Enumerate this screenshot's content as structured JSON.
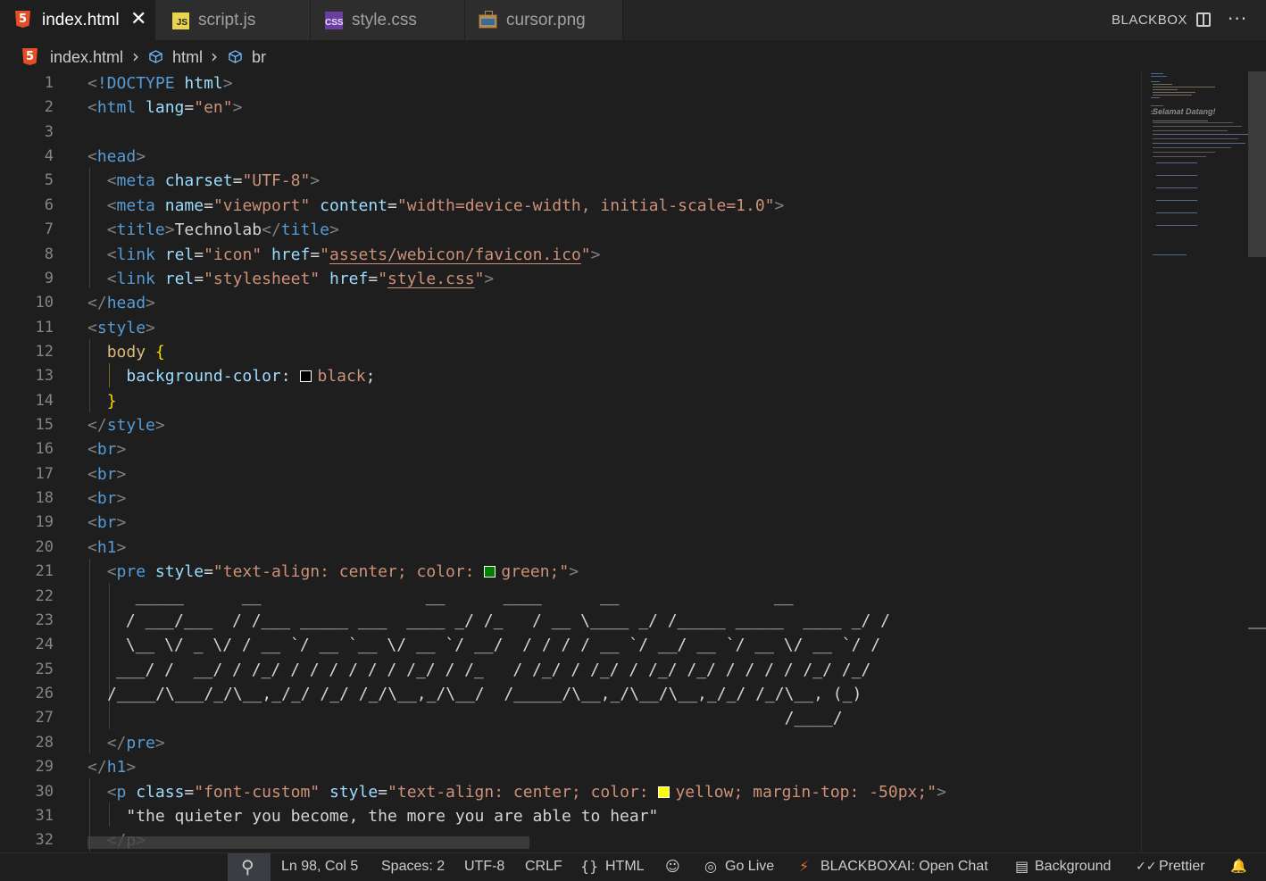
{
  "tabs": [
    {
      "label": "index.html",
      "icon": "html5-icon",
      "active": true
    },
    {
      "label": "script.js",
      "icon": "js-file-icon",
      "active": false
    },
    {
      "label": "style.css",
      "icon": "css-file-icon",
      "active": false
    },
    {
      "label": "cursor.png",
      "icon": "image-file-icon",
      "active": false
    }
  ],
  "tab_icon_text": {
    "html": "5",
    "js": "JS",
    "css": "CSS"
  },
  "close_glyph": "✕",
  "top_right": {
    "label": "BLACKBOX",
    "more": "···"
  },
  "breadcrumb": {
    "file": "index.html",
    "sep": "›",
    "items": [
      "html",
      "br"
    ]
  },
  "editor": {
    "line_numbers": [
      "1",
      "2",
      "3",
      "4",
      "5",
      "6",
      "7",
      "8",
      "9",
      "10",
      "11",
      "12",
      "13",
      "14",
      "15",
      "16",
      "17",
      "18",
      "19",
      "20",
      "21",
      "22",
      "23",
      "24",
      "25",
      "26",
      "27",
      "28",
      "29",
      "30",
      "31",
      "32"
    ],
    "ascii_art": [
      "  _____      __                 __      ____      __                __",
      " / ___/___  / /___ _____ ___  ____ _/ /_   / __ \\____ _/ /_____ _____  ____ _/ /",
      " \\__ \\/ _ \\/ / __ `/ __ `__ \\/ __ `/ __/  / / / / __ `/ __/ __ `/ __ \\/ __ `/ /",
      "___/ /  __/ / /_/ / / / / / / /_/ / /_   / /_/ / /_/ / /_/ /_/ / / / / /_/ /_/",
      "/____/\\___/_/\\__,_/_/ /_/ /_/\\__,_/\\__/  /_____/\\__,_/\\__/\\__,_/_/ /_/\\__, (_)",
      "                                                                      /____/"
    ],
    "text_title": "Technolab",
    "text_quote": "\"the quieter you become, the more you are able to hear\""
  },
  "colors": {
    "swatch_black": "#000000",
    "swatch_green": "#008000",
    "swatch_yellow": "#ffff00"
  },
  "minimap_label": "Selamat Datang!",
  "statusbar": {
    "zoom_icon": "⚲",
    "cursor_pos": "Ln 98, Col 5",
    "spaces": "Spaces: 2",
    "encoding": "UTF-8",
    "eol": "CRLF",
    "lang_icon": "{}",
    "language": "HTML",
    "copilot_icon": "☺",
    "golive_icon": "◎",
    "go_live": "Go Live",
    "blackbox_icon": "⚡",
    "blackbox": "BLACKBOXAI: Open Chat",
    "background_icon": "▤",
    "background": "Background",
    "prettier_icon": "✓✓",
    "prettier": "Prettier",
    "bell_icon": "🔔"
  }
}
